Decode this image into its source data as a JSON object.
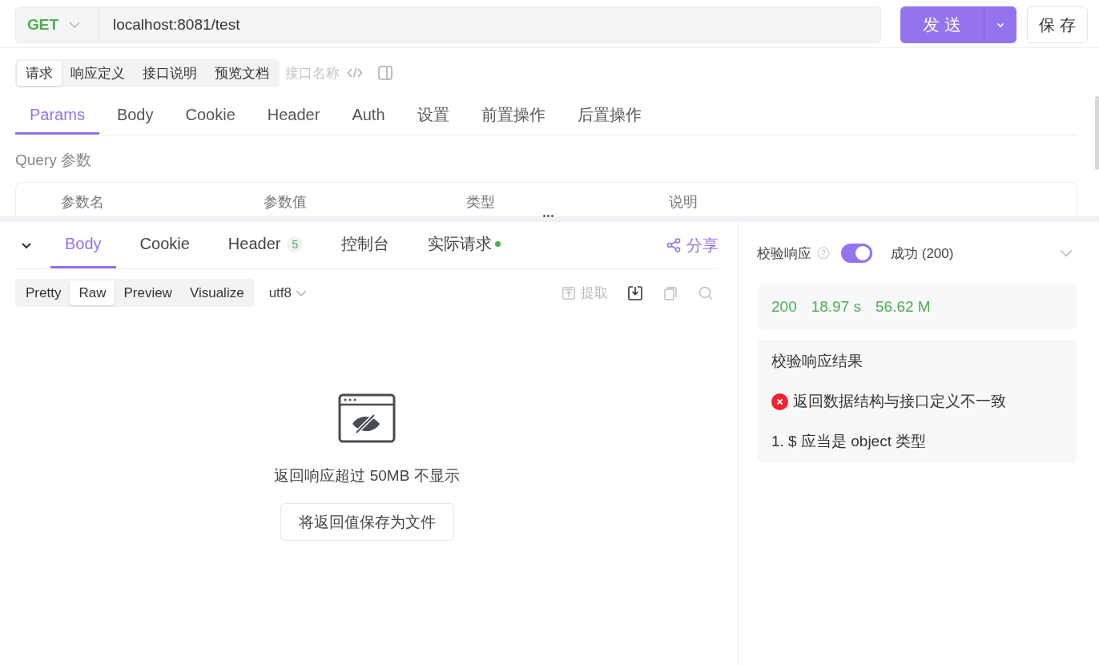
{
  "request_bar": {
    "method": "GET",
    "url": "localhost:8081/test",
    "send_label": "发送",
    "save_label": "保存"
  },
  "view_tabs": [
    {
      "label": "请求",
      "selected": true
    },
    {
      "label": "响应定义",
      "selected": false
    },
    {
      "label": "接口说明",
      "selected": false
    },
    {
      "label": "预览文档",
      "selected": false
    }
  ],
  "name_placeholder": "接口名称",
  "request_tabs": [
    {
      "label": "Params",
      "selected": true
    },
    {
      "label": "Body",
      "selected": false
    },
    {
      "label": "Cookie",
      "selected": false
    },
    {
      "label": "Header",
      "selected": false
    },
    {
      "label": "Auth",
      "selected": false
    },
    {
      "label": "设置",
      "selected": false
    },
    {
      "label": "前置操作",
      "selected": false
    },
    {
      "label": "后置操作",
      "selected": false
    }
  ],
  "query_section": {
    "title": "Query 参数",
    "columns": [
      "参数名",
      "参数值",
      "类型",
      "说明"
    ]
  },
  "response_tabs": [
    {
      "label": "Body",
      "selected": true
    },
    {
      "label": "Cookie",
      "selected": false
    },
    {
      "label": "Header",
      "selected": false,
      "count": "5"
    },
    {
      "label": "控制台",
      "selected": false
    },
    {
      "label": "实际请求",
      "selected": false,
      "indicator": true
    }
  ],
  "share_label": "分享",
  "format_tabs": [
    {
      "label": "Pretty",
      "selected": false
    },
    {
      "label": "Raw",
      "selected": true
    },
    {
      "label": "Preview",
      "selected": false
    },
    {
      "label": "Visualize",
      "selected": false
    }
  ],
  "encoding": "utf8",
  "extract_label": "提取",
  "empty_state": {
    "message": "返回响应超过 50MB 不显示",
    "button": "将返回值保存为文件"
  },
  "validation": {
    "label": "校验响应",
    "enabled": true,
    "status": "成功 (200)"
  },
  "metrics": [
    "200",
    "18.97 s",
    "56.62 M"
  ],
  "result": {
    "title": "校验响应结果",
    "error": "返回数据结构与接口定义不一致",
    "details": [
      "1. $ 应当是 object 类型"
    ]
  }
}
